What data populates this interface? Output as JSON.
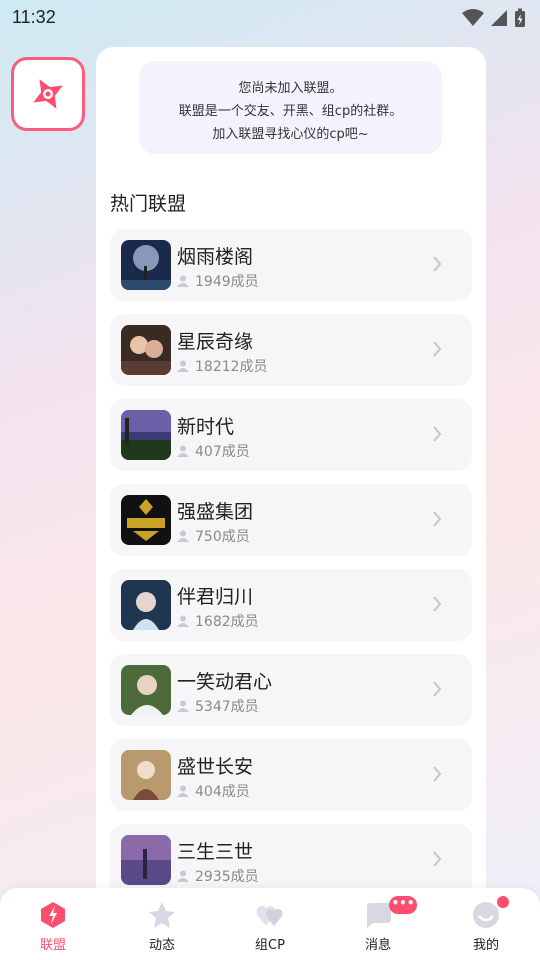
{
  "status_bar": {
    "time": "11:32"
  },
  "notice": {
    "line1": "您尚未加入联盟。",
    "line2": "联盟是一个交友、开黑、组cp的社群。",
    "line3": "加入联盟寻找心仪的cp吧~"
  },
  "section_title": "热门联盟",
  "alliances": [
    {
      "name": "烟雨楼阁",
      "members": "1949成员"
    },
    {
      "name": "星辰奇缘",
      "members": "18212成员"
    },
    {
      "name": "新时代",
      "members": "407成员"
    },
    {
      "name": "强盛集团",
      "members": "750成员"
    },
    {
      "name": "伴君归川",
      "members": "1682成员"
    },
    {
      "name": "一笑动君心",
      "members": "5347成员"
    },
    {
      "name": "盛世长安",
      "members": "404成员"
    },
    {
      "name": "三生三世",
      "members": "2935成员"
    }
  ],
  "nav": {
    "items": [
      {
        "label": "联盟",
        "icon": "alliance-icon",
        "active": true
      },
      {
        "label": "动态",
        "icon": "star-icon",
        "active": false
      },
      {
        "label": "组CP",
        "icon": "hearts-icon",
        "active": false
      },
      {
        "label": "消息",
        "icon": "chat-icon",
        "active": false
      },
      {
        "label": "我的",
        "icon": "profile-icon",
        "active": false
      }
    ]
  },
  "colors": {
    "accent": "#ff4d6d",
    "panel": "#ffffff",
    "card": "#f6f6f8",
    "notice": "#f4f3fd"
  }
}
